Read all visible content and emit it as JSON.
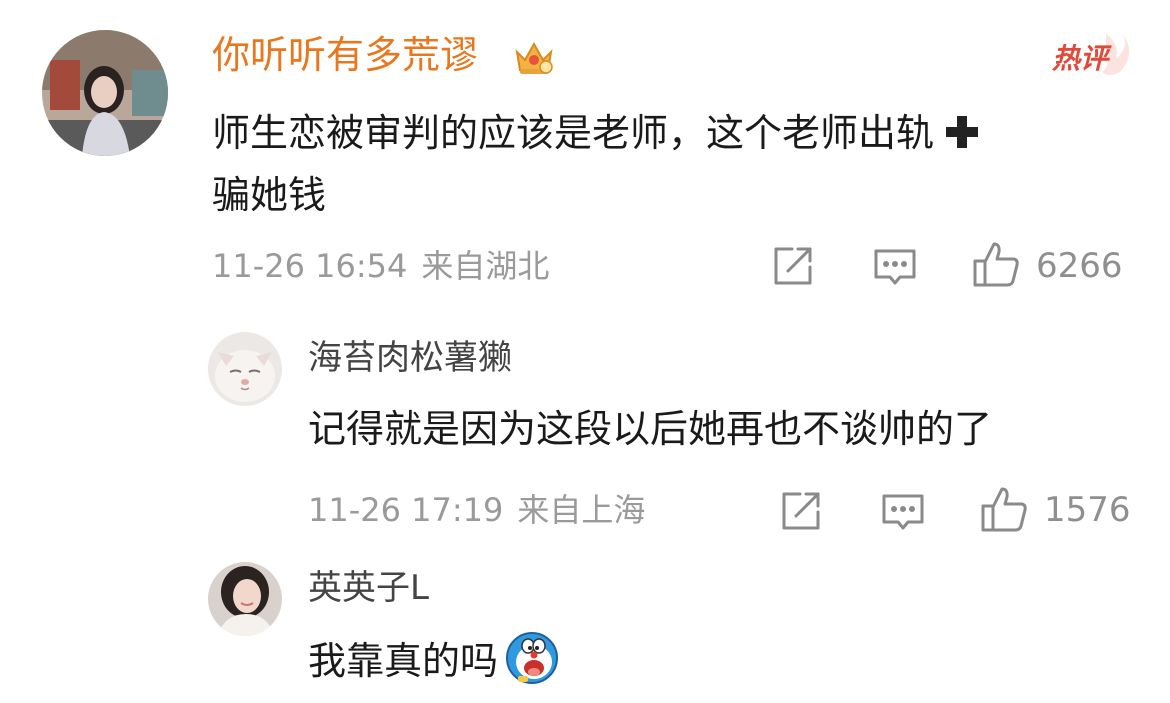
{
  "comments": [
    {
      "username": "你听听有多荒谬",
      "badge_label": "热评",
      "text_line1": "师生恋被审判的应该是老师，这个老师出轨",
      "text_line2": "骗她钱",
      "time": "11-26 16:54",
      "location": "来自湖北",
      "likes": "6266",
      "colors": {
        "username": "#e8771e",
        "badge": "#e04a3a"
      }
    },
    {
      "username": "海苔肉松薯獭",
      "text": "记得就是因为这段以后她再也不谈帅的了",
      "time": "11-26 17:19",
      "location": "来自上海",
      "likes": "1576"
    },
    {
      "username": "英英子L",
      "text": "我靠真的吗"
    }
  ],
  "icons": [
    "crown-icon",
    "plus-icon",
    "share-icon",
    "reply-icon",
    "like-icon",
    "doraemon-emoji-icon"
  ]
}
